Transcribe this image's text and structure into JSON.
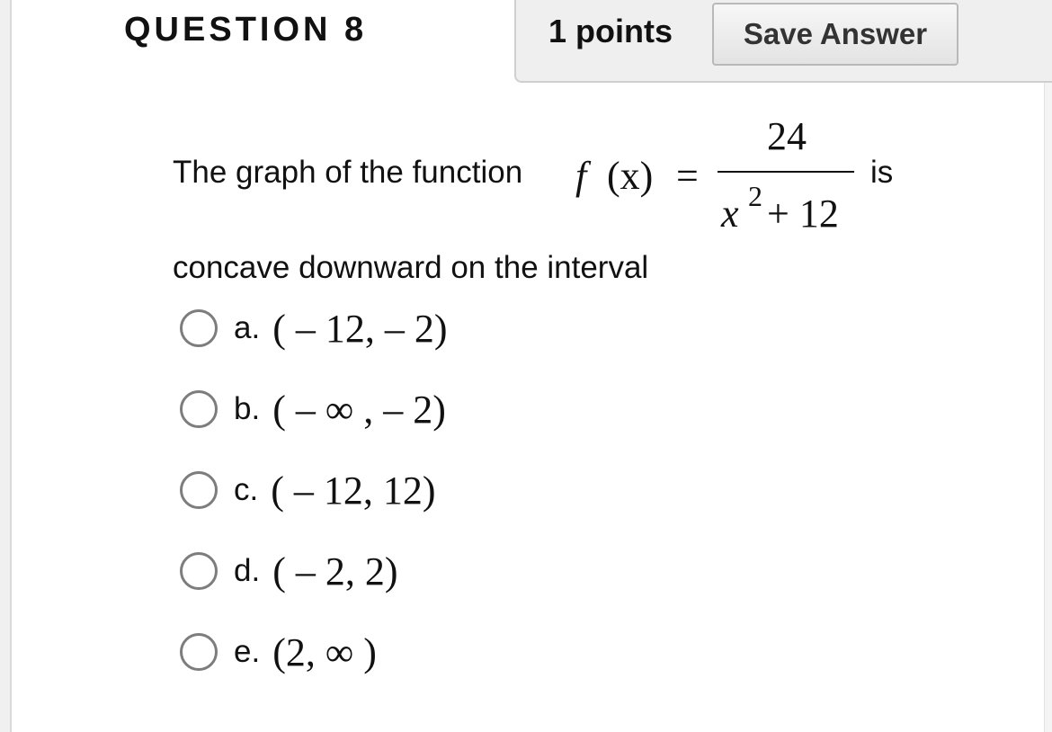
{
  "question": {
    "title": "QUESTION 8",
    "points": "1 points",
    "save_label": "Save Answer"
  },
  "prompt": {
    "text_before": "The graph of the function",
    "func_f": "f",
    "func_arg": "(x)",
    "equals": "=",
    "numerator": "24",
    "denom_x": "x",
    "denom_exp": "2",
    "denom_rest": "+ 12",
    "text_after": "is",
    "line2": "concave downward on the interval"
  },
  "options": [
    {
      "letter": "a.",
      "math": "( – 12, – 2)"
    },
    {
      "letter": "b.",
      "math": "( – ∞ , – 2)"
    },
    {
      "letter": "c.",
      "math": "( – 12, 12)"
    },
    {
      "letter": "d.",
      "math": "( – 2, 2)"
    },
    {
      "letter": "e.",
      "math": "(2, ∞ )"
    }
  ]
}
